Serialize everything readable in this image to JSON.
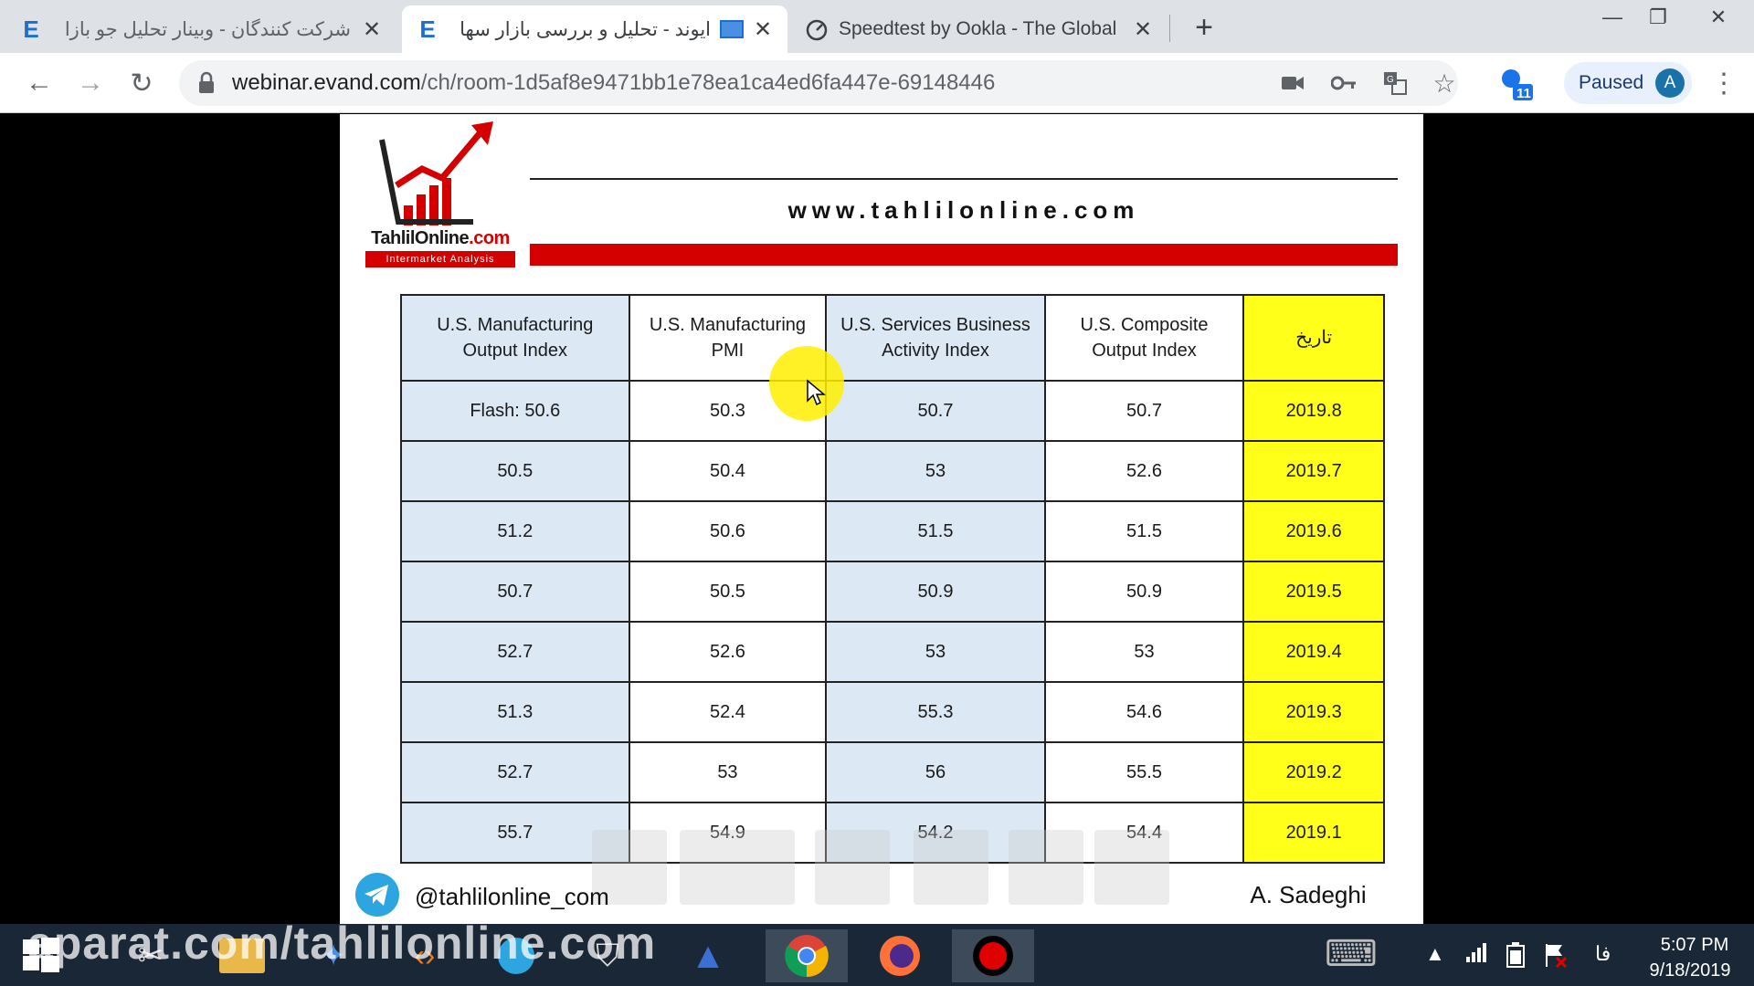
{
  "tabs": [
    {
      "title": "شرکت کنندگان - وبینار تحلیل جو بازا",
      "favicon": "evand-icon",
      "active": false
    },
    {
      "title": "ایوند - تحلیل و بررسی بازار سها",
      "favicon": "evand-icon",
      "active": true
    },
    {
      "title": "Speedtest by Ookla - The Global",
      "favicon": "speedometer-icon",
      "active": false
    }
  ],
  "toolbar": {
    "url_domain": "webinar.evand.com",
    "url_path": "/ch/room-1d5af8e9471bb1e78ea1ca4ed6fa447e-69148446",
    "paused_label": "Paused",
    "avatar_letter": "A",
    "extension_badge": "11"
  },
  "slide": {
    "logo_name": "TahlilOnline",
    "logo_tld": ".com",
    "logo_tagline": "Intermarket Analysis",
    "site_url": "www.tahlilonline.com",
    "table": {
      "headers": [
        "U.S. Manufacturing Output Index",
        "U.S. Manufacturing PMI",
        "U.S. Services Business Activity Index",
        "U.S. Composite Output Index",
        "تاریخ"
      ],
      "rows": [
        [
          "Flash: 50.6",
          "50.3",
          "50.7",
          "50.7",
          "2019.8"
        ],
        [
          "50.5",
          "50.4",
          "53",
          "52.6",
          "2019.7"
        ],
        [
          "51.2",
          "50.6",
          "51.5",
          "51.5",
          "2019.6"
        ],
        [
          "50.7",
          "50.5",
          "50.9",
          "50.9",
          "2019.5"
        ],
        [
          "52.7",
          "52.6",
          "53",
          "53",
          "2019.4"
        ],
        [
          "51.3",
          "52.4",
          "55.3",
          "54.6",
          "2019.3"
        ],
        [
          "52.7",
          "53",
          "56",
          "55.5",
          "2019.2"
        ],
        [
          "55.7",
          "54.9",
          "54.2",
          "54.4",
          "2019.1"
        ]
      ]
    },
    "telegram_handle": "@tahlilonline_com",
    "author": "A. Sadeghi"
  },
  "taskbar": {
    "watermark": "aparat.com/tahlilonline.com",
    "language": "فا",
    "time": "5:07 PM",
    "date": "9/18/2019"
  },
  "colors": {
    "brand_red": "#d40000",
    "date_column_yellow": "#ffff1a",
    "blue_column": "#dce9f5"
  }
}
